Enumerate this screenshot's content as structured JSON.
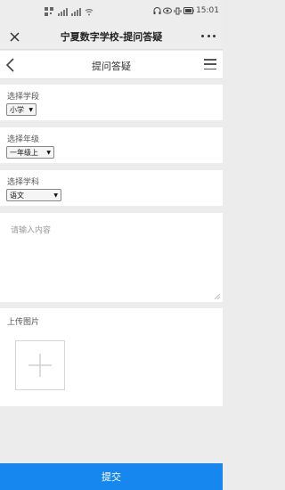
{
  "status_bar": {
    "time": "15:01"
  },
  "app_bar": {
    "title": "宁夏数字学校-提问答疑"
  },
  "header": {
    "title": "提问答疑"
  },
  "form": {
    "stage": {
      "label": "选择学段",
      "value": "小学"
    },
    "grade": {
      "label": "选择年级",
      "value": "一年级上"
    },
    "subject": {
      "label": "选择学科",
      "value": "语文"
    },
    "content": {
      "placeholder": "请输入内容"
    },
    "upload": {
      "label": "上传图片"
    }
  },
  "submit": {
    "label": "提交"
  },
  "colors": {
    "accent": "#1787f0",
    "background": "#ececec"
  }
}
